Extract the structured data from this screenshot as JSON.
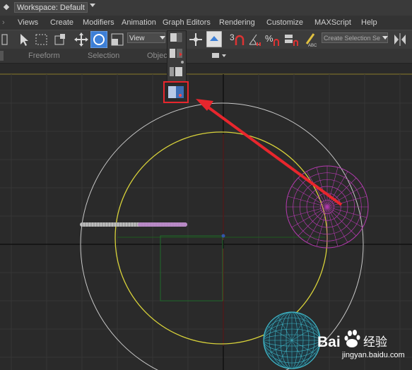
{
  "titlebar": {
    "workspace_label": "Workspace: Default"
  },
  "menubar": {
    "items": [
      "Views",
      "Create",
      "Modifiers",
      "Animation",
      "Graph Editors",
      "Rendering",
      "Customize",
      "MAXScript",
      "Help"
    ]
  },
  "toolbar": {
    "view_select": "View",
    "snap_number": "3",
    "named_selection": "Create Selection Se"
  },
  "ribbon": {
    "tabs": [
      "Freeform",
      "Selection",
      "Objec"
    ]
  },
  "watermark": {
    "logo_text": "Bai",
    "logo_suffix": "经验",
    "url": "jingyan.baidu.com"
  },
  "colors": {
    "highlight": "#e8262d",
    "circle_white": "#c8c8c8",
    "circle_yellow": "#d8d23a",
    "sphere_magenta": "#b53ab0",
    "sphere_cyan": "#3fb7c8",
    "active_tool": "#3d7fd6"
  }
}
